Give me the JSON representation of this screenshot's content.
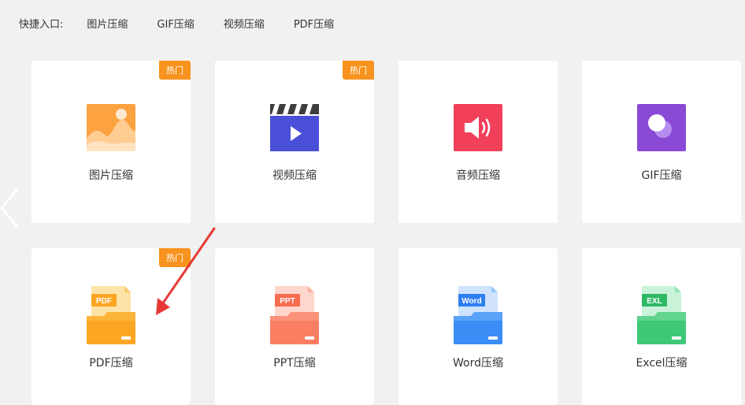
{
  "quick_entry": {
    "label": "快捷入口:",
    "links": [
      "图片压缩",
      "GIF压缩",
      "视频压缩",
      "PDF压缩"
    ]
  },
  "badge_text": "热门",
  "cards": [
    {
      "label": "图片压缩",
      "icon": "image-icon",
      "hot": true
    },
    {
      "label": "视频压缩",
      "icon": "video-icon",
      "hot": true
    },
    {
      "label": "音频压缩",
      "icon": "audio-icon",
      "hot": false
    },
    {
      "label": "GIF压缩",
      "icon": "gif-icon",
      "hot": false
    },
    {
      "label": "PDF压缩",
      "icon": "pdf-file-icon",
      "hot": true,
      "icon_text": "PDF"
    },
    {
      "label": "PPT压缩",
      "icon": "ppt-file-icon",
      "hot": false,
      "icon_text": "PPT"
    },
    {
      "label": "Word压缩",
      "icon": "word-file-icon",
      "hot": false,
      "icon_text": "Word"
    },
    {
      "label": "Excel压缩",
      "icon": "excel-file-icon",
      "hot": false,
      "icon_text": "EXL"
    }
  ],
  "colors": {
    "hot_badge": "#f7931e",
    "image": "#fca240",
    "video": "#4a4fd8",
    "audio": "#f2405a",
    "gif": "#8a4ad6",
    "pdf": "#fcae1e",
    "ppt": "#fa7e62",
    "word": "#3a8ef6",
    "excel": "#3ec877",
    "annotation_arrow": "#e53935"
  }
}
